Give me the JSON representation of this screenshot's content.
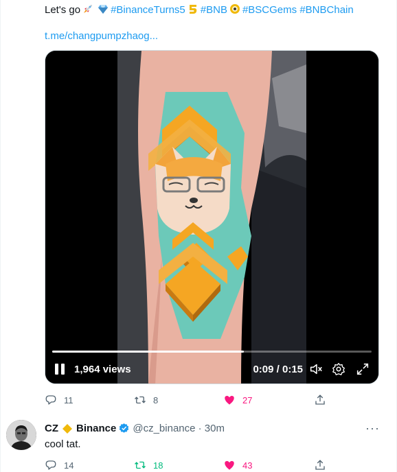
{
  "tweet": {
    "text_prefix": "Let's go",
    "hashtag_binance": "#BinanceTurns5",
    "hashtag_bnb": "#BNB",
    "hashtag_bscgems": "#BSCGems",
    "hashtag_bnbchain": "#BNBChain",
    "link": "t.me/changpumpzhaog...",
    "video": {
      "views": "1,964 views",
      "time": "0:09 / 0:15",
      "progress": 0.6
    },
    "actions": {
      "replies": "11",
      "retweets": "8",
      "likes": "27"
    }
  },
  "reply": {
    "name": "CZ",
    "org": "Binance",
    "handle_time": "@cz_binance · 30m",
    "text": "cool tat.",
    "more": "···",
    "actions": {
      "replies": "14",
      "retweets": "18",
      "likes": "43"
    }
  },
  "colors": {
    "accent": "#1d9bf0",
    "like": "#f91880",
    "retweet": "#00ba7c",
    "muted": "#536471",
    "verified": "#1d9bf0",
    "binance_gold": "#f0b90b"
  }
}
